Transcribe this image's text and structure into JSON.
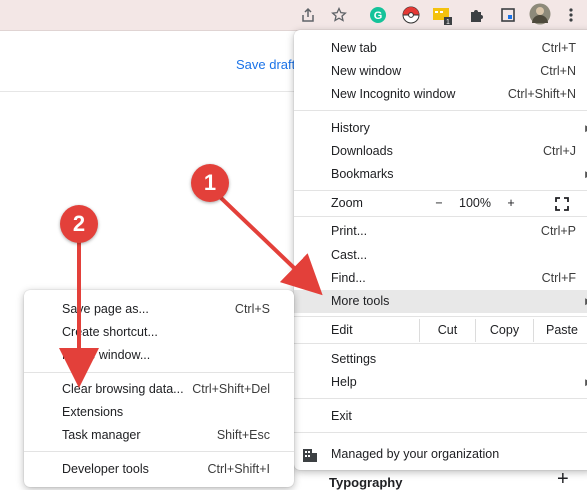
{
  "toolbar": {
    "icons": [
      "share-icon",
      "star-icon",
      "grammarly-icon",
      "pokeball-icon",
      "extension-yellow-icon",
      "puzzle-icon",
      "window-icon",
      "profile-avatar",
      "kebab-menu-icon"
    ],
    "extension_badge": "1"
  },
  "page": {
    "save_draft": "Save draft",
    "typography": "Typography",
    "plus": "+"
  },
  "main_menu": {
    "new_tab": {
      "label": "New tab",
      "shortcut": "Ctrl+T"
    },
    "new_window": {
      "label": "New window",
      "shortcut": "Ctrl+N"
    },
    "new_incognito": {
      "label": "New Incognito window",
      "shortcut": "Ctrl+Shift+N"
    },
    "history": {
      "label": "History"
    },
    "downloads": {
      "label": "Downloads",
      "shortcut": "Ctrl+J"
    },
    "bookmarks": {
      "label": "Bookmarks"
    },
    "zoom": {
      "label": "Zoom",
      "minus": "−",
      "value": "100%",
      "plus": "+"
    },
    "print": {
      "label": "Print...",
      "shortcut": "Ctrl+P"
    },
    "cast": {
      "label": "Cast..."
    },
    "find": {
      "label": "Find...",
      "shortcut": "Ctrl+F"
    },
    "more_tools": {
      "label": "More tools"
    },
    "edit": {
      "label": "Edit",
      "cut": "Cut",
      "copy": "Copy",
      "paste": "Paste"
    },
    "settings": {
      "label": "Settings"
    },
    "help": {
      "label": "Help"
    },
    "exit": {
      "label": "Exit"
    },
    "managed": {
      "label": "Managed by your organization"
    }
  },
  "sub_menu": {
    "save_page": {
      "label": "Save page as...",
      "shortcut": "Ctrl+S"
    },
    "create_shortcut": {
      "label": "Create shortcut..."
    },
    "name_window": {
      "label": "Name window..."
    },
    "clear_browsing": {
      "label": "Clear browsing data...",
      "shortcut": "Ctrl+Shift+Del"
    },
    "extensions": {
      "label": "Extensions"
    },
    "task_manager": {
      "label": "Task manager",
      "shortcut": "Shift+Esc"
    },
    "developer_tools": {
      "label": "Developer tools",
      "shortcut": "Ctrl+Shift+I"
    }
  },
  "annotations": {
    "badge_1": "1",
    "badge_2": "2",
    "color": "#e3403a"
  }
}
